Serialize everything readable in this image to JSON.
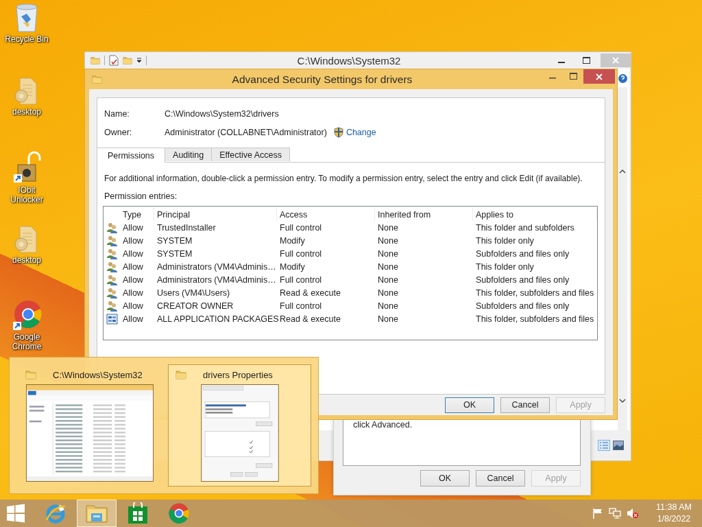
{
  "desktop_icons": [
    {
      "label": "Recycle Bin",
      "kind": "recycle"
    },
    {
      "label": "desktop",
      "kind": "file"
    },
    {
      "label": "IObit Unlocker",
      "kind": "lock"
    },
    {
      "label": "desktop",
      "kind": "file"
    },
    {
      "label": "Google Chrome",
      "kind": "chrome"
    }
  ],
  "explorer_window": {
    "title": "C:\\Windows\\System32"
  },
  "properties_dialog": {
    "text": "click Advanced.",
    "buttons": [
      {
        "label": "OK",
        "disabled": false
      },
      {
        "label": "Cancel",
        "disabled": false
      },
      {
        "label": "Apply",
        "disabled": true
      }
    ]
  },
  "security_dialog": {
    "title": "Advanced Security Settings for drivers",
    "name_label": "Name:",
    "name": "C:\\Windows\\System32\\drivers",
    "owner_label": "Owner:",
    "owner": "Administrator (COLLABNET\\Administrator)",
    "change_link": "Change",
    "tabs": [
      {
        "label": "Permissions",
        "selected": true
      },
      {
        "label": "Auditing",
        "selected": false
      },
      {
        "label": "Effective Access",
        "selected": false
      }
    ],
    "info": "For additional information, double-click a permission entry. To modify a permission entry, select the entry and click Edit (if available).",
    "entries_label": "Permission entries:",
    "table": {
      "columns": [
        "Type",
        "Principal",
        "Access",
        "Inherited from",
        "Applies to"
      ],
      "rows": [
        {
          "kind": "group",
          "cells": [
            "Allow",
            "TrustedInstaller",
            "Full control",
            "None",
            "This folder and subfolders"
          ]
        },
        {
          "kind": "group",
          "cells": [
            "Allow",
            "SYSTEM",
            "Modify",
            "None",
            "This folder only"
          ]
        },
        {
          "kind": "group",
          "cells": [
            "Allow",
            "SYSTEM",
            "Full control",
            "None",
            "Subfolders and files only"
          ]
        },
        {
          "kind": "group",
          "cells": [
            "Allow",
            "Administrators (VM4\\Adminis…",
            "Modify",
            "None",
            "This folder only"
          ]
        },
        {
          "kind": "group",
          "cells": [
            "Allow",
            "Administrators (VM4\\Adminis…",
            "Full control",
            "None",
            "Subfolders and files only"
          ]
        },
        {
          "kind": "group",
          "cells": [
            "Allow",
            "Users (VM4\\Users)",
            "Read & execute",
            "None",
            "This folder, subfolders and files"
          ]
        },
        {
          "kind": "group",
          "cells": [
            "Allow",
            "CREATOR OWNER",
            "Full control",
            "None",
            "Subfolders and files only"
          ]
        },
        {
          "kind": "package",
          "cells": [
            "Allow",
            "ALL APPLICATION PACKAGES",
            "Read & execute",
            "None",
            "This folder, subfolders and files"
          ]
        }
      ]
    },
    "buttons": [
      {
        "label": "OK",
        "disabled": false
      },
      {
        "label": "Cancel",
        "disabled": false
      },
      {
        "label": "Apply",
        "disabled": true
      }
    ]
  },
  "task_thumbnails": [
    {
      "title": "C:\\Windows\\System32",
      "kind": "explorer",
      "selected": false
    },
    {
      "title": "drivers Properties",
      "kind": "properties",
      "selected": true
    }
  ],
  "taskbar": {
    "apps": [
      {
        "kind": "browser",
        "selected": false
      },
      {
        "kind": "explorer",
        "selected": true
      },
      {
        "kind": "store",
        "selected": false
      },
      {
        "kind": "chrome",
        "selected": false
      }
    ],
    "time": "11:38 AM",
    "date": "1/8/2022"
  }
}
